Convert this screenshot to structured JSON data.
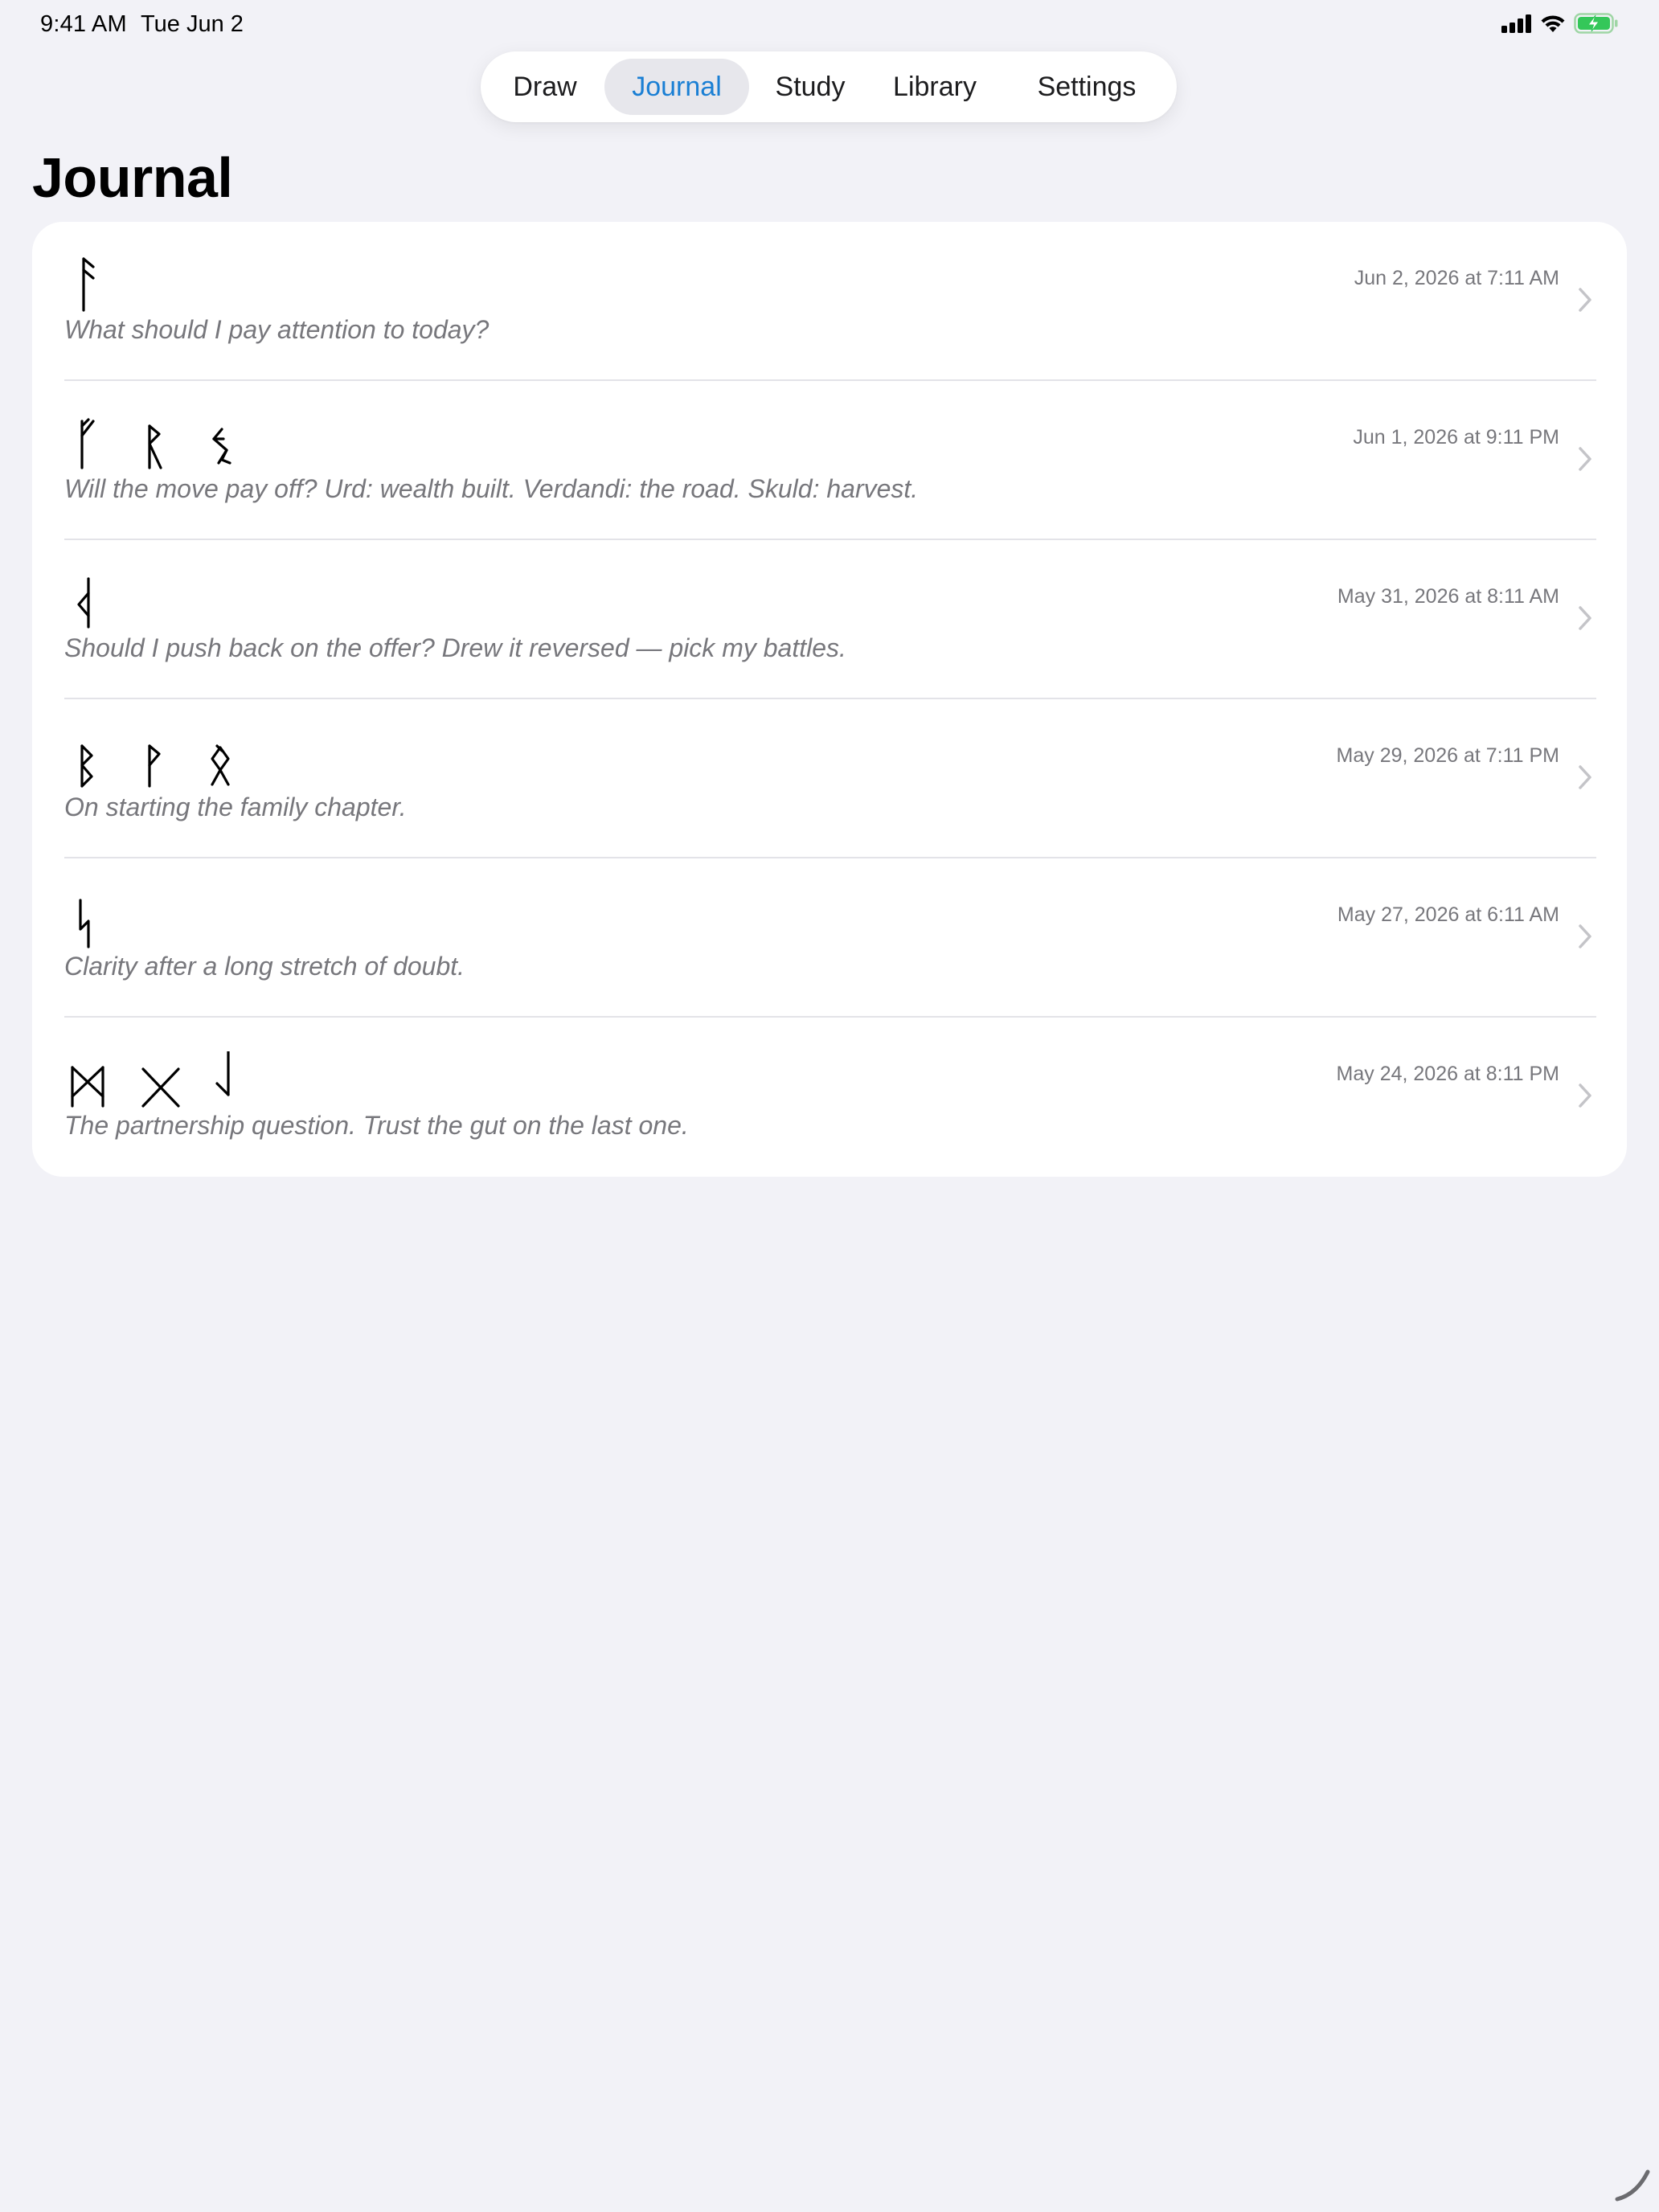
{
  "status_bar": {
    "time": "9:41 AM",
    "date": "Tue Jun 2",
    "icons": [
      "cellular-signal-icon",
      "wifi-icon",
      "battery-charging-icon"
    ]
  },
  "tabs": [
    {
      "label": "Draw",
      "selected": false
    },
    {
      "label": "Journal",
      "selected": true
    },
    {
      "label": "Study",
      "selected": false
    },
    {
      "label": "Library",
      "selected": false
    },
    {
      "label": "Settings",
      "selected": false
    }
  ],
  "page": {
    "title": "Journal"
  },
  "entries": [
    {
      "runes": [
        "ansuz"
      ],
      "date": "Jun 2, 2026 at 7:11 AM",
      "note": "What should I pay attention to today?"
    },
    {
      "runes": [
        "fehu",
        "raidho",
        "sowilo"
      ],
      "date": "Jun 1, 2026 at 9:11 PM",
      "note": "Will the move pay off? Urd: wealth built. Verdandi: the road. Skuld: harvest."
    },
    {
      "runes": [
        "kenaz-reversed"
      ],
      "date": "May 31, 2026 at 8:11 AM",
      "note": "Should I push back on the offer? Drew it reversed — pick my battles."
    },
    {
      "runes": [
        "berkano",
        "wunjo",
        "othala"
      ],
      "date": "May 29, 2026 at 7:11 PM",
      "note": "On starting the family chapter."
    },
    {
      "runes": [
        "sowilo-variant"
      ],
      "date": "May 27, 2026 at 6:11 AM",
      "note": "Clarity after a long stretch of doubt."
    },
    {
      "runes": [
        "mannaz",
        "gebo",
        "laguz-reversed"
      ],
      "date": "May 24, 2026 at 8:11 PM",
      "note": "The partnership question. Trust the gut on the last one."
    }
  ],
  "colors": {
    "background": "#f2f2f7",
    "accent": "#1a7fd4",
    "secondary_text": "#77777c",
    "card": "#ffffff"
  }
}
